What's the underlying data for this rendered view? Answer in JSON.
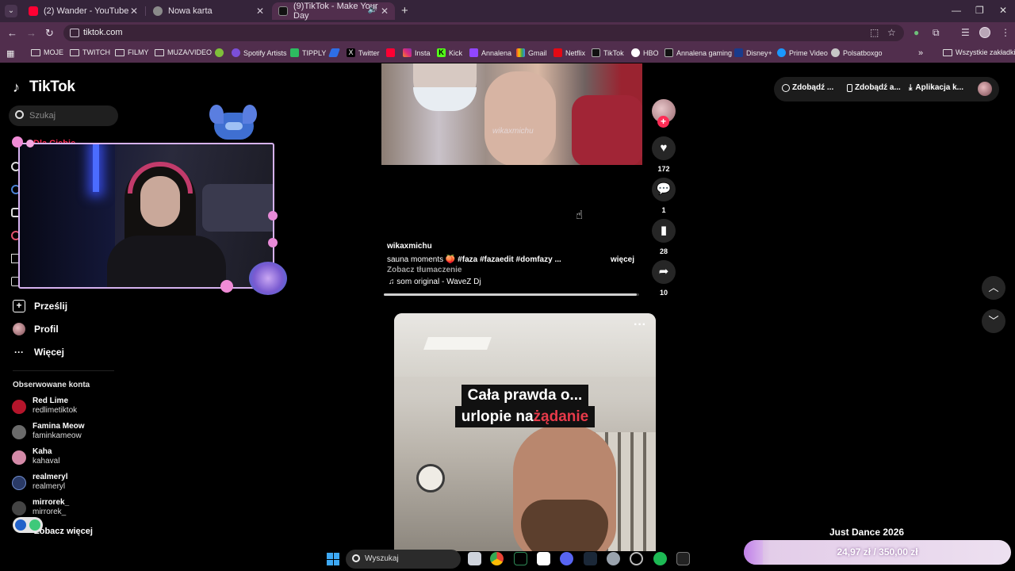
{
  "browser": {
    "tabs": [
      {
        "label": "(2) Wander - YouTube",
        "favicon_color": "#ff0033"
      },
      {
        "label": "Nowa karta",
        "favicon_color": "#8a8a8a"
      },
      {
        "label": "(9)TikTok - Make Your Day",
        "favicon_color": "#111111"
      }
    ],
    "url": "tiktok.com",
    "bookmarks": [
      {
        "label": "MOJE",
        "icon": "folder-icon"
      },
      {
        "label": "TWITCH",
        "icon": "folder-icon"
      },
      {
        "label": "FILMY",
        "icon": "folder-icon"
      },
      {
        "label": "MUZA/VIDEO",
        "icon": "folder-icon"
      },
      {
        "label": "Spotify Artists",
        "icon": "spotify-icon"
      },
      {
        "label": "TIPPLY",
        "icon": "tipply-icon"
      },
      {
        "label": "Twitter",
        "icon": "x-icon"
      },
      {
        "label": "Insta",
        "icon": "instagram-icon"
      },
      {
        "label": "Kick",
        "icon": "kick-icon"
      },
      {
        "label": "Annalena",
        "icon": "twitch-icon"
      },
      {
        "label": "Gmail",
        "icon": "gmail-icon"
      },
      {
        "label": "Netflix",
        "icon": "netflix-icon"
      },
      {
        "label": "TikTok",
        "icon": "tiktok-icon"
      },
      {
        "label": "HBO",
        "icon": "hbo-icon"
      },
      {
        "label": "Annalena gaming",
        "icon": "tiktok-icon"
      },
      {
        "label": "Disney+",
        "icon": "disney-icon"
      },
      {
        "label": "Prime Video",
        "icon": "prime-icon"
      },
      {
        "label": "Polsatboxgo",
        "icon": "polsat-icon"
      }
    ],
    "all_bookmarks": "Wszystkie zakładki"
  },
  "tiktok": {
    "logo": "TikTok",
    "search_placeholder": "Szukaj",
    "nav_partial": "Dla Ciebie",
    "nav": [
      {
        "label": "Prześlij",
        "icon": "upload-icon"
      },
      {
        "label": "Profil",
        "icon": "profile-icon"
      },
      {
        "label": "Więcej",
        "icon": "more-icon"
      }
    ],
    "following_title": "Obserwowane konta",
    "following": [
      {
        "name": "Red Lime",
        "handle": "redlimetiktok",
        "avatar_color": "#b5152b"
      },
      {
        "name": "Famina Meow",
        "handle": "faminkameow",
        "avatar_color": "#6b6b6b"
      },
      {
        "name": "Kaha",
        "handle": "kahaval",
        "avatar_color": "#d48aa8"
      },
      {
        "name": "realmeryl",
        "handle": "realmeryl",
        "avatar_color": "#2a3a66"
      },
      {
        "name": "mirrorek_",
        "handle": "mirrorek_",
        "avatar_color": "#444444"
      }
    ],
    "see_more": "Zobacz więcej",
    "top_buttons": [
      "Zdobądź ...",
      "Zdobądź a...",
      "Aplikacja k..."
    ],
    "post1": {
      "watermark": "wikaxmichu",
      "username": "wikaxmichu",
      "caption": "sauna moments 🍑",
      "hashtags": [
        "#faza",
        "#fazaedit",
        "#domfazy"
      ],
      "ellipsis": "...",
      "more": "więcej",
      "translate": "Zobacz tłumaczenie",
      "sound": "som original - WaveZ Dj",
      "likes": "172",
      "comments": "1",
      "saves": "28",
      "shares": "10",
      "progress": 0.99
    },
    "post2": {
      "line1": "Cała prawda o...",
      "line2a": "urlopie na ",
      "line2b": "żądanie",
      "menu": "···"
    }
  },
  "overlay": {
    "goal_title": "Just Dance 2026",
    "goal_current": "24,97 zł",
    "goal_sep": "/",
    "goal_target": "350,00 zł",
    "goal_progress": 0.0713
  },
  "taskbar": {
    "search_placeholder": "Wyszukaj"
  },
  "colors": {
    "chrome_tab_bg": "#35243a",
    "chrome_toolbar": "#512e4d",
    "tiktok_red": "#fe2c55"
  }
}
